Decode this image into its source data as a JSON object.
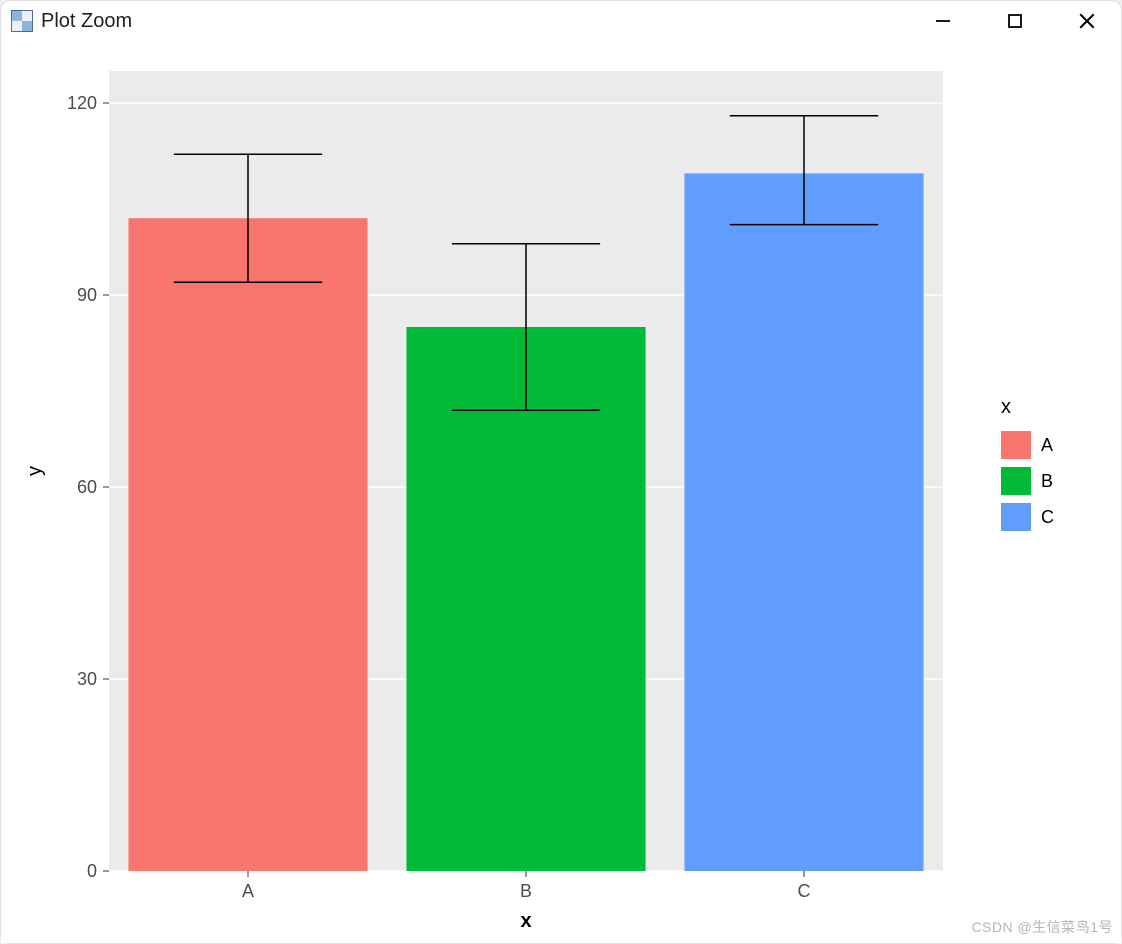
{
  "window": {
    "title": "Plot Zoom"
  },
  "watermark": "CSDN @生信菜鸟1号",
  "chart_data": {
    "type": "bar",
    "categories": [
      "A",
      "B",
      "C"
    ],
    "series": [
      {
        "name": "A",
        "value": 102,
        "err_low": 92,
        "err_high": 112,
        "color": "#F8766D"
      },
      {
        "name": "B",
        "value": 85,
        "err_low": 72,
        "err_high": 98,
        "color": "#00BA38"
      },
      {
        "name": "C",
        "value": 109,
        "err_low": 101,
        "err_high": 118,
        "color": "#619CFF"
      }
    ],
    "xlabel": "x",
    "ylabel": "y",
    "legend_title": "x",
    "y_ticks": [
      0,
      30,
      60,
      90,
      120
    ],
    "ylim": [
      0,
      125
    ],
    "panel_bg": "#EBEBEB",
    "grid_color": "#FFFFFF"
  }
}
